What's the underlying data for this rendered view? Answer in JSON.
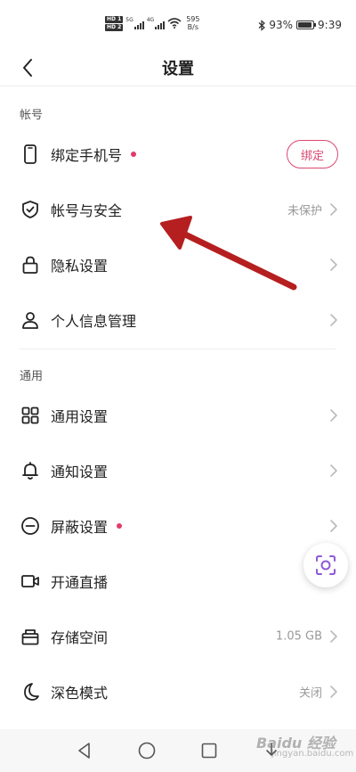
{
  "status_bar": {
    "hd1": "HD 1",
    "hd2": "HD 2",
    "net1": "5G",
    "net2": "4G",
    "speed_value": "595",
    "speed_unit": "B/s",
    "battery": "93%",
    "battery_level": 0.93,
    "time": "9:39"
  },
  "header": {
    "title": "设置"
  },
  "sections": {
    "account": "帐号",
    "general": "通用"
  },
  "rows": {
    "bind_phone": {
      "label": "绑定手机号",
      "has_dot": true,
      "button": "绑定"
    },
    "account_security": {
      "label": "帐号与安全",
      "value": "未保护"
    },
    "privacy": {
      "label": "隐私设置"
    },
    "personal_info": {
      "label": "个人信息管理"
    },
    "general_settings": {
      "label": "通用设置"
    },
    "notification": {
      "label": "通知设置"
    },
    "block": {
      "label": "屏蔽设置",
      "has_dot": true
    },
    "live": {
      "label": "开通直播"
    },
    "storage": {
      "label": "存储空间",
      "value": "1.05 GB"
    },
    "dark_mode": {
      "label": "深色模式",
      "value": "关闭"
    }
  },
  "icons": {
    "back": "back-chevron-icon",
    "phone": "phone-icon",
    "shield": "shield-check-icon",
    "lock": "lock-icon",
    "person": "person-icon",
    "grid": "grid-icon",
    "bell": "bell-icon",
    "block": "minus-circle-icon",
    "video": "video-camera-icon",
    "storage": "box-icon",
    "moon": "moon-icon",
    "scan": "scan-icon"
  },
  "colors": {
    "accent": "#d9486f",
    "dot": "#e23a6a",
    "annotation_arrow": "#b51f1f",
    "scan_icon": "#8f5ad6"
  },
  "watermark": {
    "text": "Baidu 经验",
    "url": "jingyan.baidu.com"
  }
}
